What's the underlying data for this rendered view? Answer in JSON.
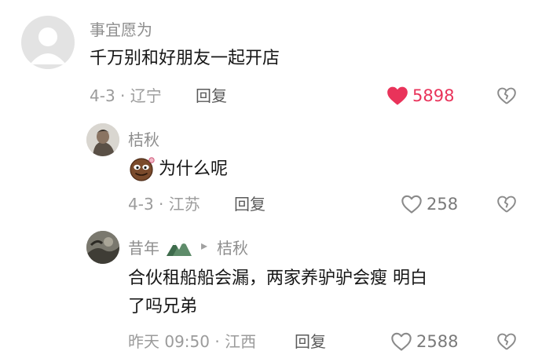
{
  "comments": [
    {
      "username": "事宜愿为",
      "text": "千万别和好朋友一起开店",
      "meta": "4-3 · 辽宁",
      "reply_label": "回复",
      "likes": "5898",
      "liked": true,
      "avatar": "default-avatar"
    },
    {
      "username": "桔秋",
      "text": "为什么呢",
      "emoji": "face-emoji",
      "meta": "4-3 · 江苏",
      "reply_label": "回复",
      "likes": "258",
      "liked": false,
      "avatar": "photo-avatar"
    },
    {
      "username": "昔年",
      "reply_arrow": "▸",
      "reply_to": "桔秋",
      "text_line1": "合伙租船船会漏，两家养驴驴会瘦 明白",
      "text_line2": "了吗兄弟",
      "meta": "昨天 09:50 · 江西",
      "reply_label": "回复",
      "likes": "2588",
      "liked": false,
      "avatar": "photo-avatar",
      "badge": "mountain-badge"
    }
  ],
  "colors": {
    "liked": "#e9335a",
    "meta": "#9b9b9b",
    "name": "#8e8e8e"
  }
}
